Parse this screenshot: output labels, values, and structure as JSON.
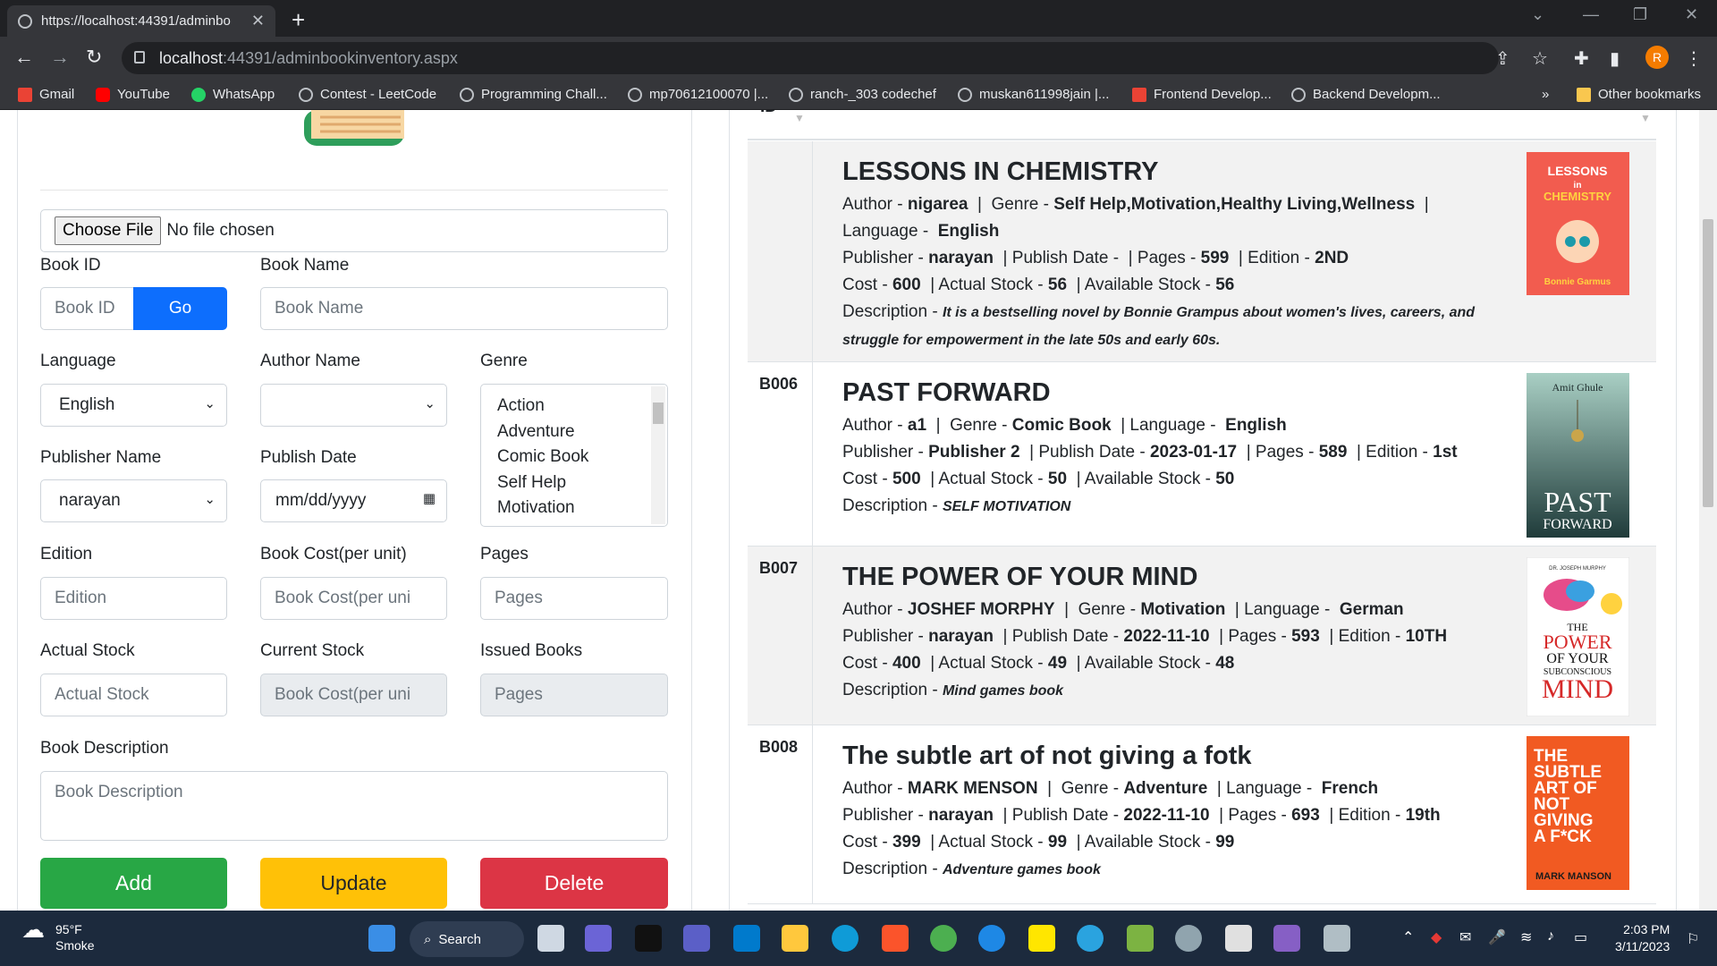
{
  "browser": {
    "tab_title": "https://localhost:44391/adminbo",
    "url_host": "localhost",
    "url_path": ":44391/adminbookinventory.aspx",
    "profile_initial": "R",
    "bookmarks": [
      "Gmail",
      "YouTube",
      "WhatsApp",
      "Contest - LeetCode",
      "Programming Chall...",
      "mp70612100070 |...",
      "ranch-_303 codechef",
      "muskan611998jain |...",
      "Frontend Develop...",
      "Backend Developm..."
    ],
    "bookmarks_more": "»",
    "other_bookmarks": "Other bookmarks"
  },
  "form": {
    "file_button": "Choose File",
    "file_status": "No file chosen",
    "book_id_label": "Book ID",
    "book_id_placeholder": "Book ID",
    "go_label": "Go",
    "book_name_label": "Book Name",
    "book_name_placeholder": "Book Name",
    "language_label": "Language",
    "language_value": "English",
    "author_label": "Author Name",
    "author_value": "",
    "genre_label": "Genre",
    "genre_options": [
      "Action",
      "Adventure",
      "Comic Book",
      "Self Help",
      "Motivation"
    ],
    "publisher_label": "Publisher Name",
    "publisher_value": "narayan",
    "publish_date_label": "Publish Date",
    "publish_date_placeholder": "mm/dd/yyyy",
    "edition_label": "Edition",
    "edition_placeholder": "Edition",
    "cost_label": "Book Cost(per unit)",
    "cost_placeholder": "Book Cost(per uni",
    "pages_label": "Pages",
    "pages_placeholder": "Pages",
    "actual_stock_label": "Actual Stock",
    "actual_stock_placeholder": "Actual Stock",
    "current_stock_label": "Current Stock",
    "current_stock_placeholder": "Book Cost(per uni",
    "issued_label": "Issued Books",
    "issued_placeholder": "Pages",
    "description_label": "Book Description",
    "description_placeholder": "Book Description",
    "add_label": "Add",
    "update_label": "Update",
    "delete_label": "Delete"
  },
  "table": {
    "id_header": "ID",
    "rows": [
      {
        "id": "",
        "title": "LESSONS IN CHEMISTRY",
        "author": "nigarea",
        "genre": "Self Help,Motivation,Healthy Living,Wellness",
        "language": "English",
        "publisher": "narayan",
        "publish_date": "",
        "pages": "599",
        "edition": "2ND",
        "cost": "600",
        "actual_stock": "56",
        "available_stock": "56",
        "description": "It is a bestselling novel by Bonnie Grampus about women's lives, careers, and struggle for empowerment in the late 50s and early 60s."
      },
      {
        "id": "B006",
        "title": "PAST FORWARD",
        "author": "a1",
        "genre": "Comic Book",
        "language": "English",
        "publisher": "Publisher 2",
        "publish_date": "2023-01-17",
        "pages": "589",
        "edition": "1st",
        "cost": "500",
        "actual_stock": "50",
        "available_stock": "50",
        "description": "SELF MOTIVATION"
      },
      {
        "id": "B007",
        "title": "THE POWER OF YOUR MIND",
        "author": "JOSHEF MORPHY",
        "genre": "Motivation",
        "language": "German",
        "publisher": "narayan",
        "publish_date": "2022-11-10",
        "pages": "593",
        "edition": "10TH",
        "cost": "400",
        "actual_stock": "49",
        "available_stock": "48",
        "description": "Mind games book"
      },
      {
        "id": "B008",
        "title": "The subtle art of not giving a fotk",
        "author": "MARK MENSON",
        "genre": "Adventure",
        "language": "French",
        "publisher": "narayan",
        "publish_date": "2022-11-10",
        "pages": "693",
        "edition": "19th",
        "cost": "399",
        "actual_stock": "99",
        "available_stock": "99",
        "description": "Adventure games book"
      }
    ],
    "labels": {
      "author": "Author",
      "genre": "Genre",
      "language": "Language",
      "publisher": "Publisher",
      "publish_date": "Publish Date",
      "pages": "Pages",
      "edition": "Edition",
      "cost": "Cost",
      "actual_stock": "Actual Stock",
      "available_stock": "Available Stock",
      "description": "Description"
    },
    "covers": [
      {
        "top_text": "LESSONS in CHEMISTRY",
        "bottom_text": "Bonnie Garmus",
        "bg": "#f25c4f"
      },
      {
        "top_text": "Amit Ghule",
        "bottom_text": "PAST FORWARD",
        "bg": "#4b7a78"
      },
      {
        "top_text": "DR. JOSEPH MURPHY",
        "bottom_text": "THE POWER OF YOUR SUBCONSCIOUS MIND",
        "bg": "#ffffff"
      },
      {
        "top_text": "THE SUBTLE ART OF NOT GIVING A F*CK",
        "bottom_text": "MARK MANSON",
        "bg": "#f15a22"
      }
    ]
  },
  "taskbar": {
    "temp": "95°F",
    "weather": "Smoke",
    "search": "Search",
    "time": "2:03 PM",
    "date": "3/11/2023"
  },
  "colors": {
    "primary": "#0d6efd",
    "success": "#28a745",
    "warning": "#ffc107",
    "danger": "#dc3545"
  }
}
